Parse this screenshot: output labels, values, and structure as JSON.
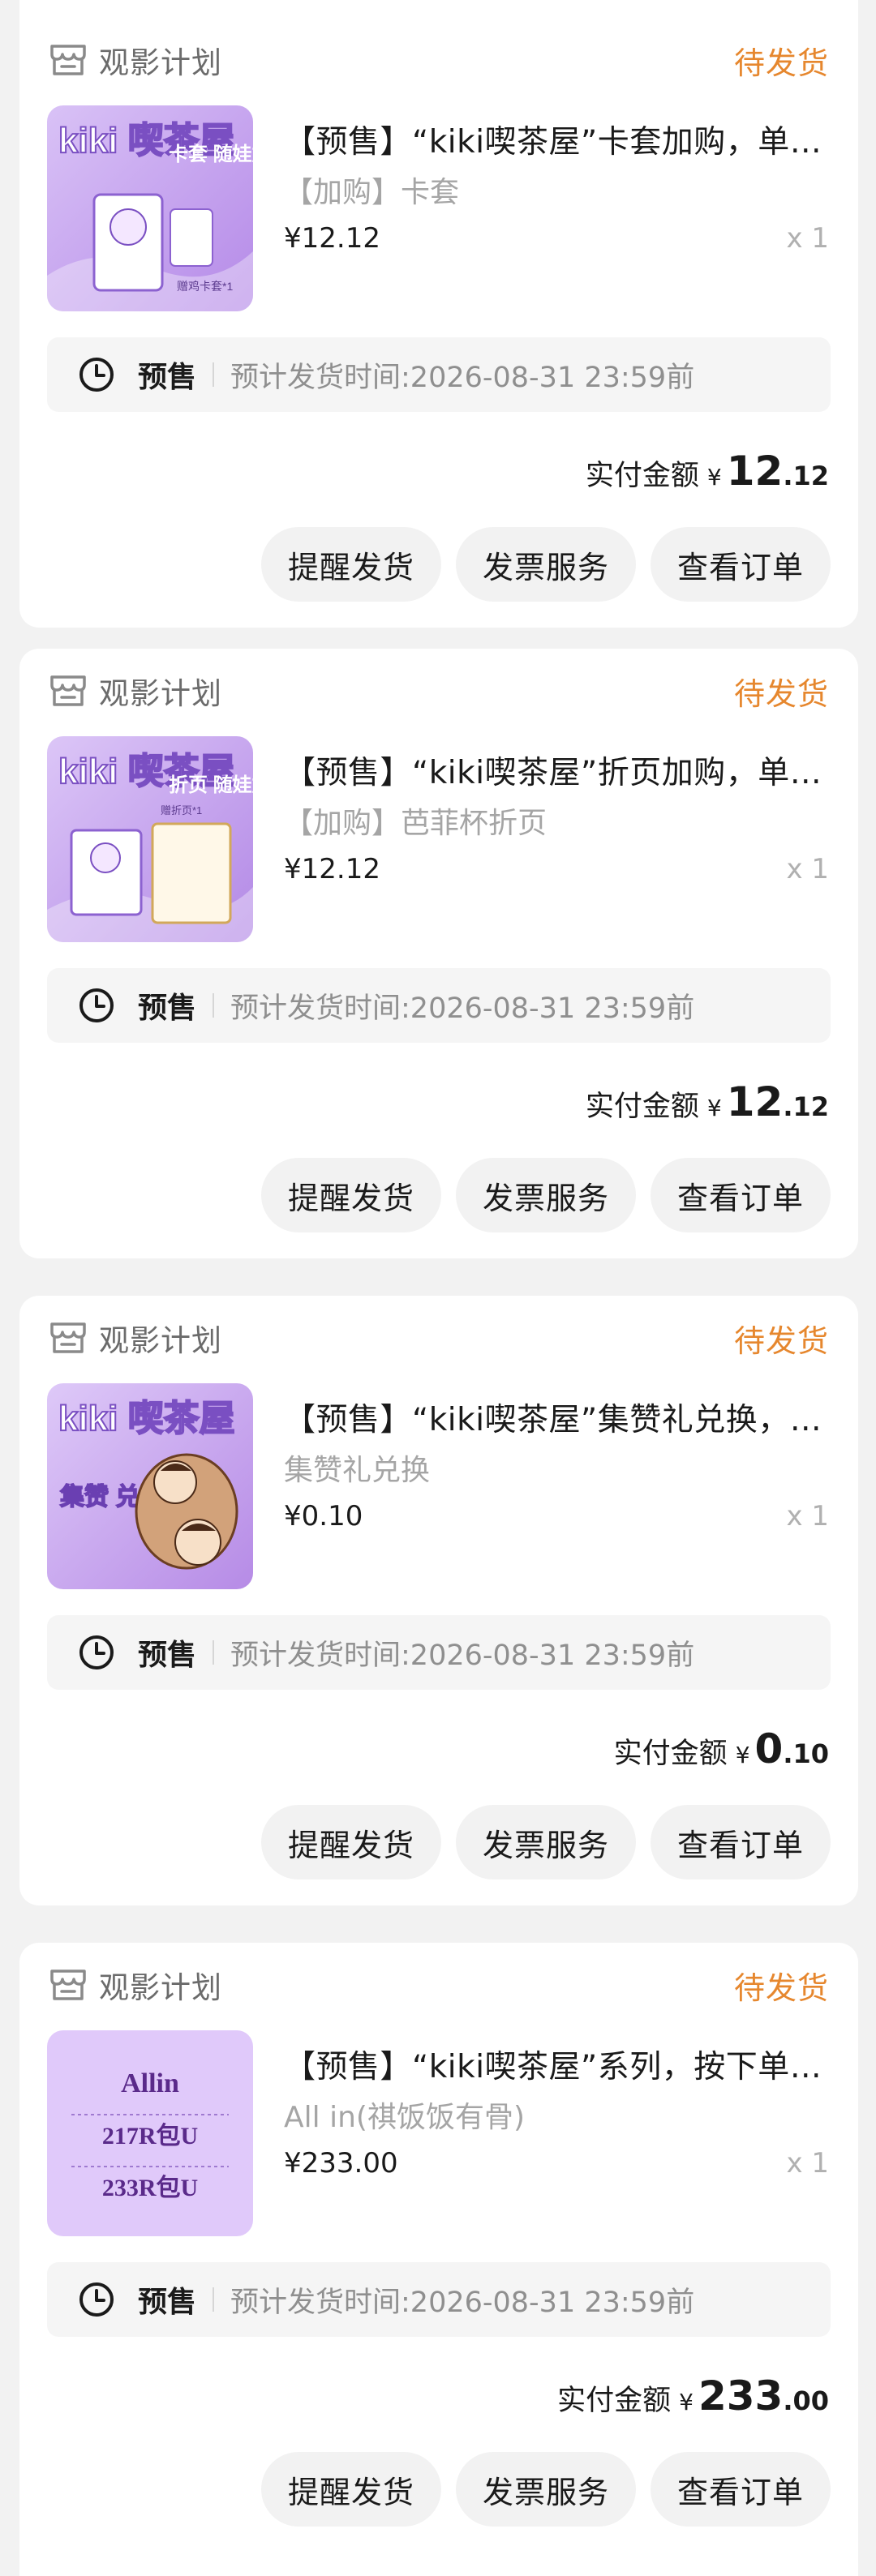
{
  "orders": [
    {
      "shop_name": "观影计划",
      "status": "待发货",
      "product_title": "【预售】“kiki喫茶屋”卡套加购，单…",
      "spec": "【加购】卡套",
      "price": "¥12.12",
      "quantity": "x 1",
      "presale_tag": "预售",
      "ship_time": "预计发货时间:2026-08-31 23:59前",
      "paid_label": "实付金额",
      "paid_currency": "¥",
      "paid_int": "12",
      "paid_dec": ".12",
      "thumb_caption": "卡套 随娃加购",
      "thumb_small": "赠鸡卡套*1",
      "thumb_logo": "kiki 喫茶屋",
      "buttons": [
        "提醒发货",
        "发票服务",
        "查看订单"
      ]
    },
    {
      "shop_name": "观影计划",
      "status": "待发货",
      "product_title": "【预售】“kiki喫茶屋”折页加购，单…",
      "spec": "【加购】芭菲杯折页",
      "price": "¥12.12",
      "quantity": "x 1",
      "presale_tag": "预售",
      "ship_time": "预计发货时间:2026-08-31 23:59前",
      "paid_label": "实付金额",
      "paid_currency": "¥",
      "paid_int": "12",
      "paid_dec": ".12",
      "thumb_caption": "折页 随娃加购",
      "thumb_small": "赠折页*1",
      "thumb_logo": "kiki 喫茶屋",
      "buttons": [
        "提醒发货",
        "发票服务",
        "查看订单"
      ]
    },
    {
      "shop_name": "观影计划",
      "status": "待发货",
      "product_title": "【预售】“kiki喫茶屋”集赞礼兑换，…",
      "spec": "集赞礼兑换",
      "price": "¥0.10",
      "quantity": "x 1",
      "presale_tag": "预售",
      "ship_time": "预计发货时间:2026-08-31 23:59前",
      "paid_label": "实付金额",
      "paid_currency": "¥",
      "paid_int": "0",
      "paid_dec": ".10",
      "thumb_caption": "集赞 兑换礼",
      "thumb_small": "",
      "thumb_logo": "kiki 喫茶屋",
      "buttons": [
        "提醒发货",
        "发票服务",
        "查看订单"
      ]
    },
    {
      "shop_name": "观影计划",
      "status": "待发货",
      "product_title": "【预售】“kiki喫茶屋”系列，按下单…",
      "spec": "All in(祺饭饭有骨)",
      "price": "¥233.00",
      "quantity": "x 1",
      "presale_tag": "预售",
      "ship_time": "预计发货时间:2026-08-31 23:59前",
      "paid_label": "实付金额",
      "paid_currency": "¥",
      "paid_int": "233",
      "paid_dec": ".00",
      "thumb_caption": "Allin",
      "thumb_line1": "217R包U",
      "thumb_line2": "233R包U",
      "buttons": [
        "提醒发货",
        "发票服务",
        "查看订单"
      ]
    }
  ],
  "colors": {
    "status": "#e6872e",
    "thumb_purple": "#c9a7ee",
    "thumb_light": "#e3cffa"
  },
  "icons": {
    "shop": "shop-store-icon",
    "clock": "clock-icon"
  }
}
